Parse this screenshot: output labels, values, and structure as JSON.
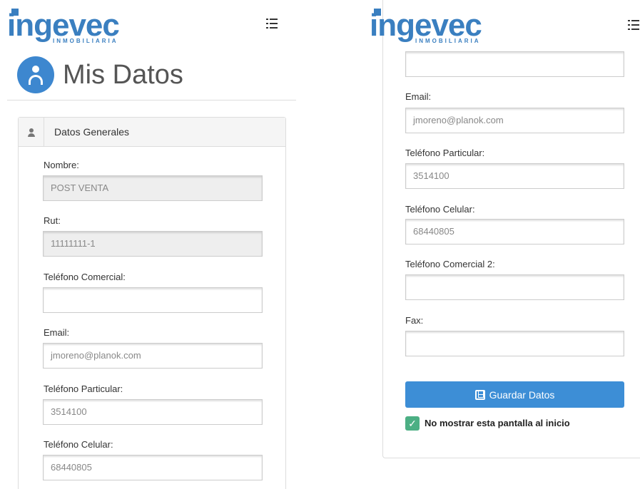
{
  "brand": {
    "name": "ingevec",
    "subtitle": "INMOBILIARIA",
    "color": "#3a7fc0"
  },
  "header": {
    "menu_icon": "list-menu-icon"
  },
  "page": {
    "title": "Mis Datos",
    "icon": "user-icon"
  },
  "section": {
    "title": "Datos Generales",
    "icon": "user-icon"
  },
  "left_fields": [
    {
      "label": "Nombre:",
      "value": "POST VENTA",
      "readonly": true
    },
    {
      "label": "Rut:",
      "value": "11111111-1",
      "readonly": true
    },
    {
      "label": "Teléfono Comercial:",
      "value": ""
    },
    {
      "label": "Email:",
      "value": "jmoreno@planok.com"
    },
    {
      "label": "Teléfono Particular:",
      "value": "3514100"
    },
    {
      "label": "Teléfono Celular:",
      "value": "68440805"
    }
  ],
  "right_fields": [
    {
      "label": "",
      "value": ""
    },
    {
      "label": "Email:",
      "value": "jmoreno@planok.com"
    },
    {
      "label": "Teléfono Particular:",
      "value": "3514100"
    },
    {
      "label": "Teléfono Celular:",
      "value": "68440805"
    },
    {
      "label": "Teléfono Comercial 2:",
      "value": ""
    },
    {
      "label": "Fax:",
      "value": ""
    }
  ],
  "actions": {
    "save_label": "Guardar Datos",
    "save_color": "#3d8ed6"
  },
  "options": {
    "hide_on_start_label": "No mostrar esta pantalla al inicio",
    "hide_on_start_checked": true
  }
}
